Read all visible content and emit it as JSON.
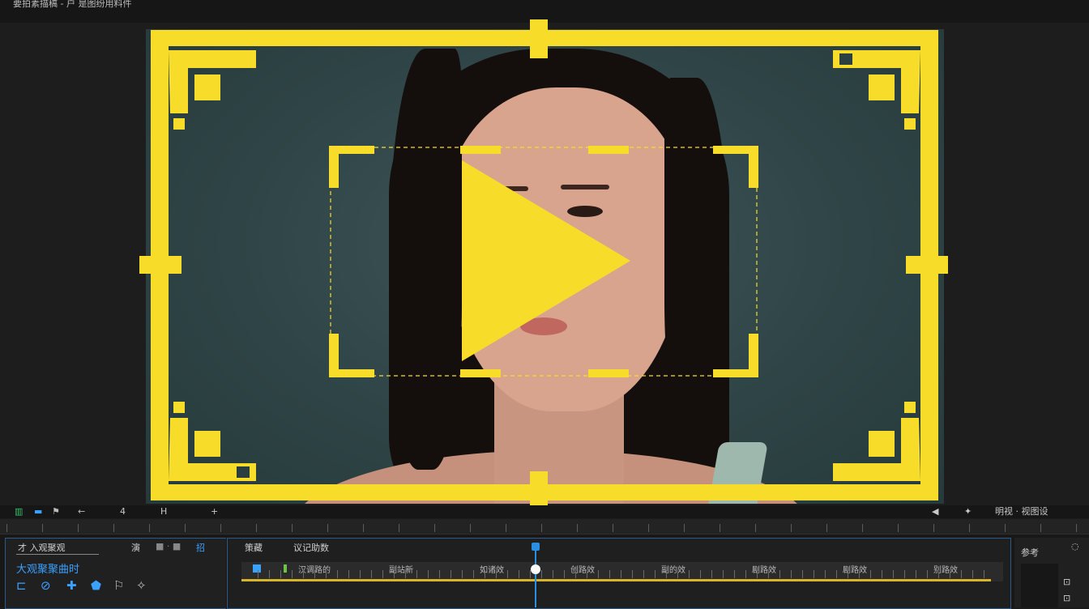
{
  "window": {
    "title": "要拍素描稿 - 户 是图纷用料件"
  },
  "overlay": {
    "accent": "#f7dd2a",
    "play_icon": "play-icon"
  },
  "controls": {
    "left_icons": [
      "layout-icon",
      "monitor-icon",
      "flag-icon",
      "arrow-left-icon"
    ],
    "counter": "4",
    "marker": "H",
    "add": "+",
    "right_icons": [
      "volume-icon",
      "pin-icon"
    ],
    "right_label": "明视 · 视图设"
  },
  "left_panel": {
    "header": "才 入观聚观",
    "subheader": "大观聚聚曲时",
    "tab1": "演",
    "tab2": "■ · ■",
    "tab3": "招",
    "tools": [
      "align-icon",
      "link-icon",
      "puzzle-icon",
      "shield-icon",
      "flag-tool-icon",
      "magic-icon"
    ]
  },
  "timeline": {
    "tab_a": "策藏",
    "tab_b": "议记助数",
    "track_labels": [
      "汉调路的",
      "副站新",
      "如诸效",
      "创路效",
      "副的效",
      "剧路效",
      "剧路效",
      "别路效"
    ]
  },
  "right_panel": {
    "label": "参考"
  }
}
